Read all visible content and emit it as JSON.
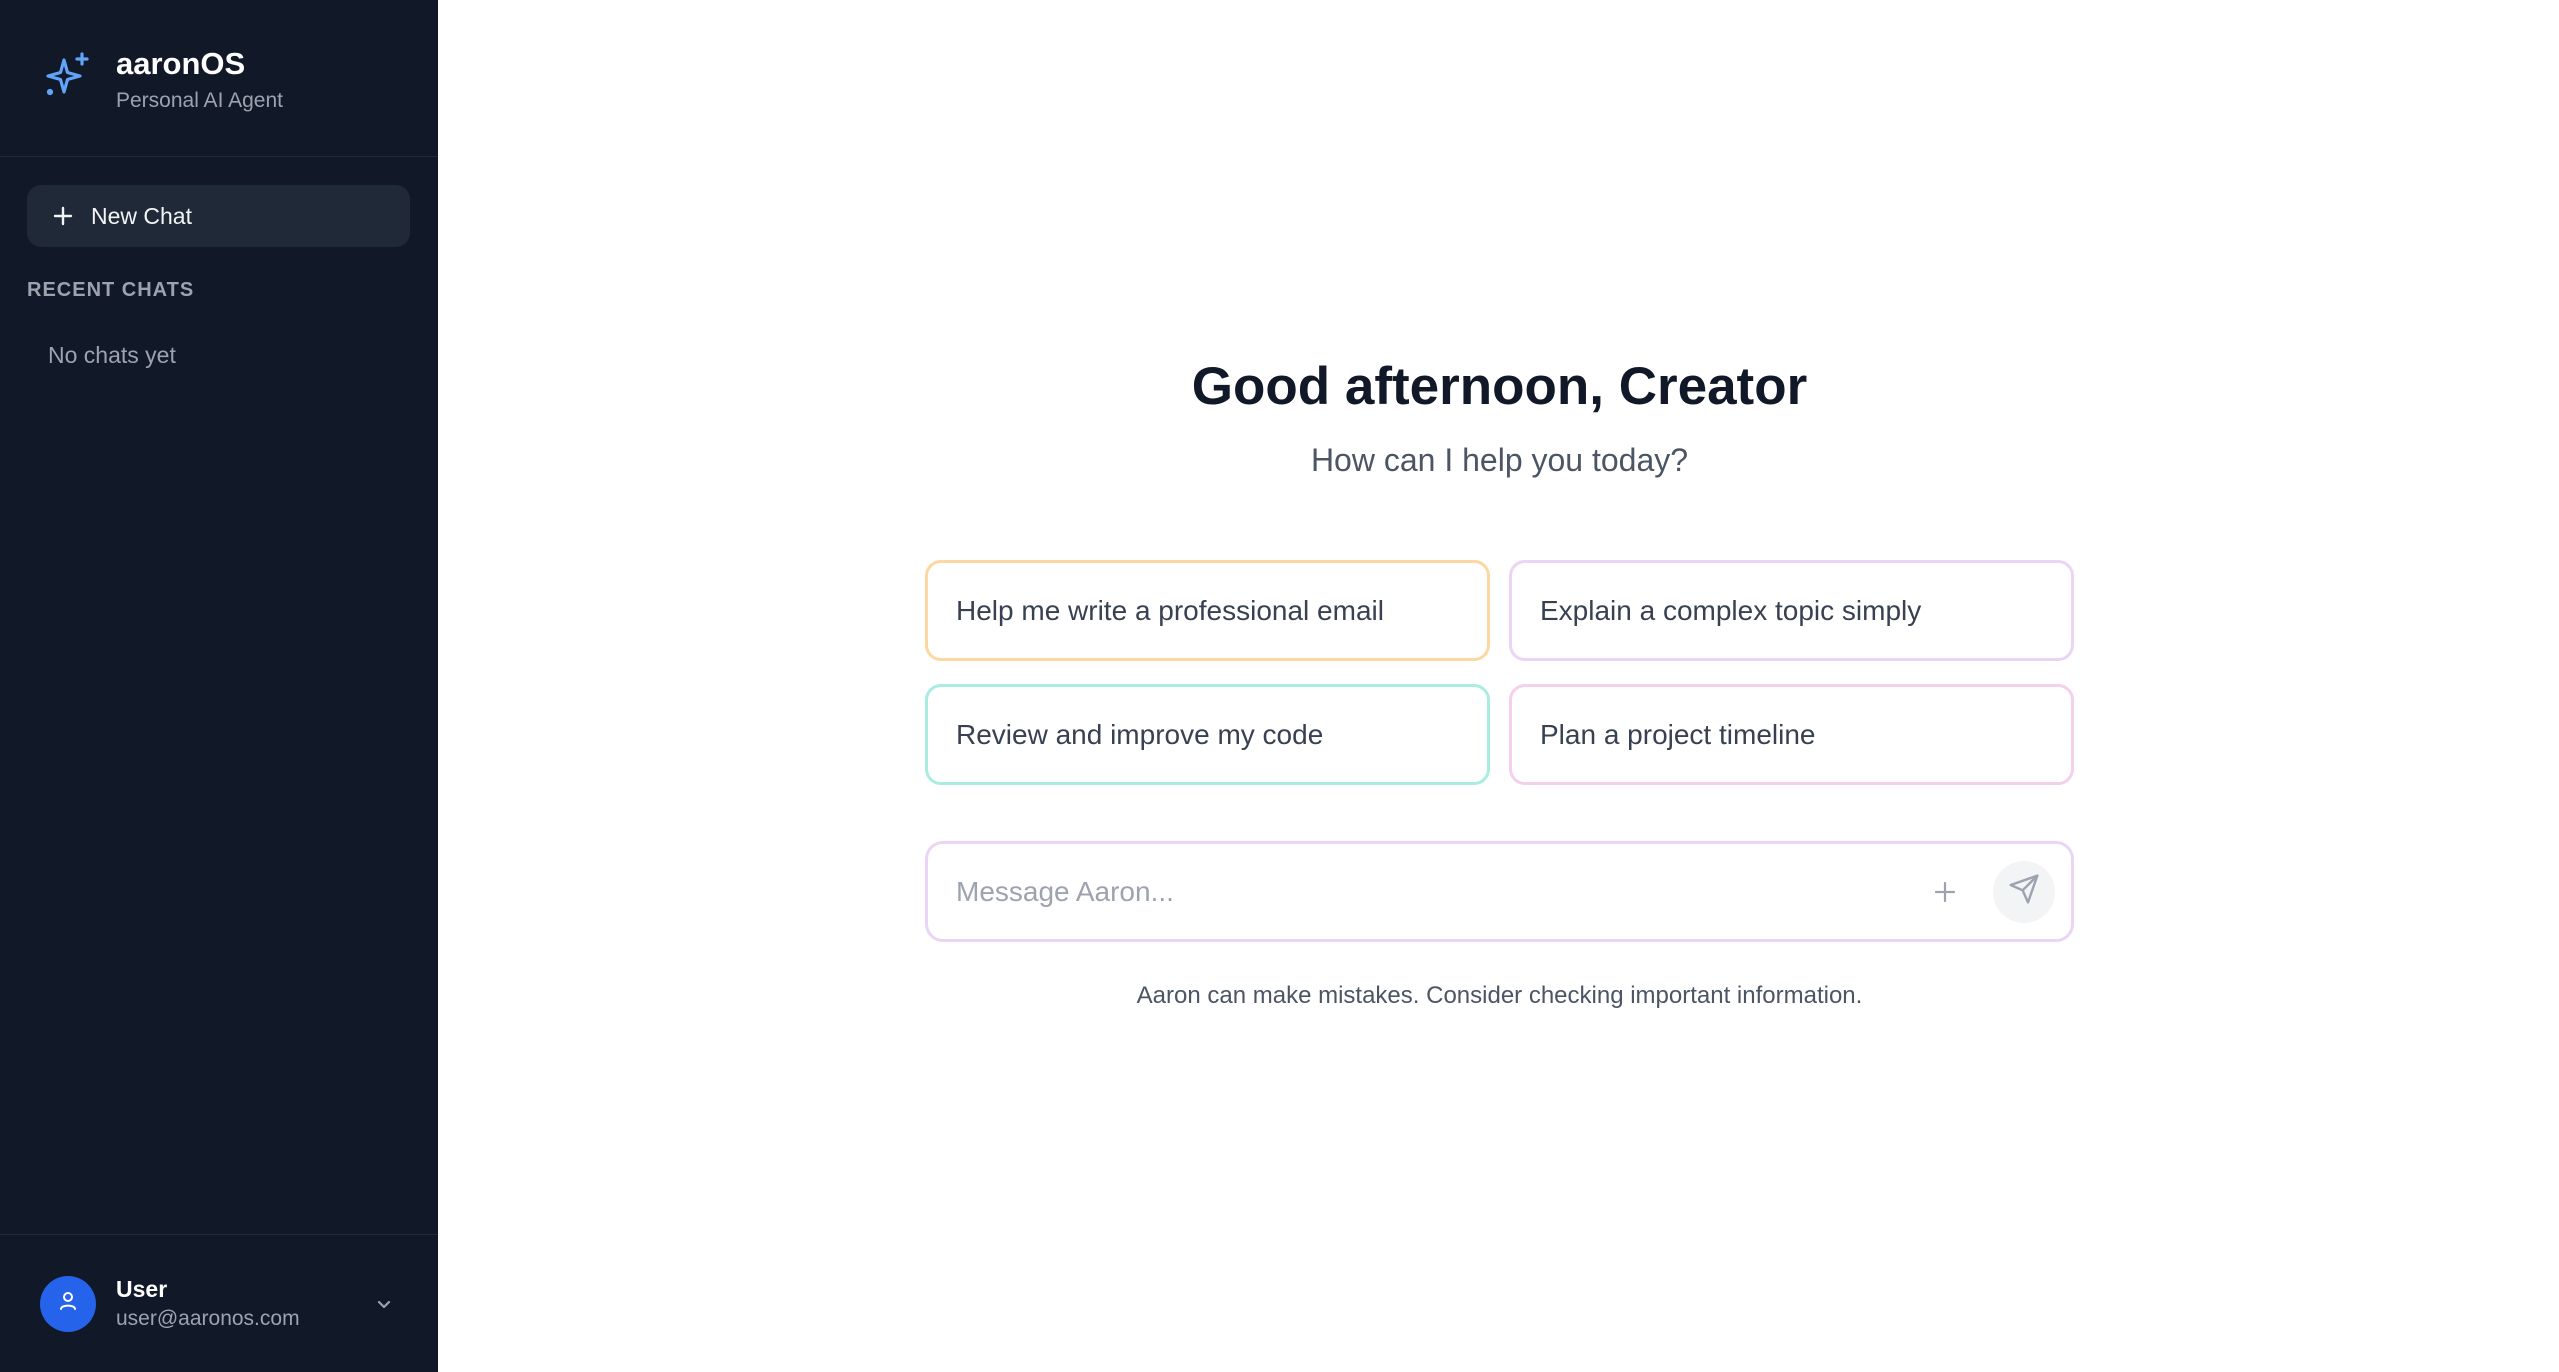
{
  "sidebar": {
    "brand_name": "aaronOS",
    "brand_subtitle": "Personal AI Agent",
    "brand_icon": "sparkle-icon",
    "new_chat_label": "New Chat",
    "recent_label": "RECENT CHATS",
    "empty_label": "No chats yet",
    "user": {
      "name": "User",
      "email": "user@aaronos.com"
    }
  },
  "main": {
    "greeting": "Good afternoon, Creator",
    "subgreeting": "How can I help you today?",
    "suggestions": [
      {
        "label": "Help me write a professional email",
        "color": "#fcd7a1"
      },
      {
        "label": "Explain a complex topic simply",
        "color": "#ead5f5"
      },
      {
        "label": "Review and improve my code",
        "color": "#a9ece0"
      },
      {
        "label": "Plan a project timeline",
        "color": "#f5d0ea"
      }
    ],
    "composer": {
      "placeholder": "Message Aaron...",
      "value": ""
    },
    "disclaimer": "Aaron can make mistakes. Consider checking important information."
  },
  "colors": {
    "sidebar_bg": "#111827",
    "accent": "#2563eb",
    "brand_icon": "#60a5fa"
  }
}
